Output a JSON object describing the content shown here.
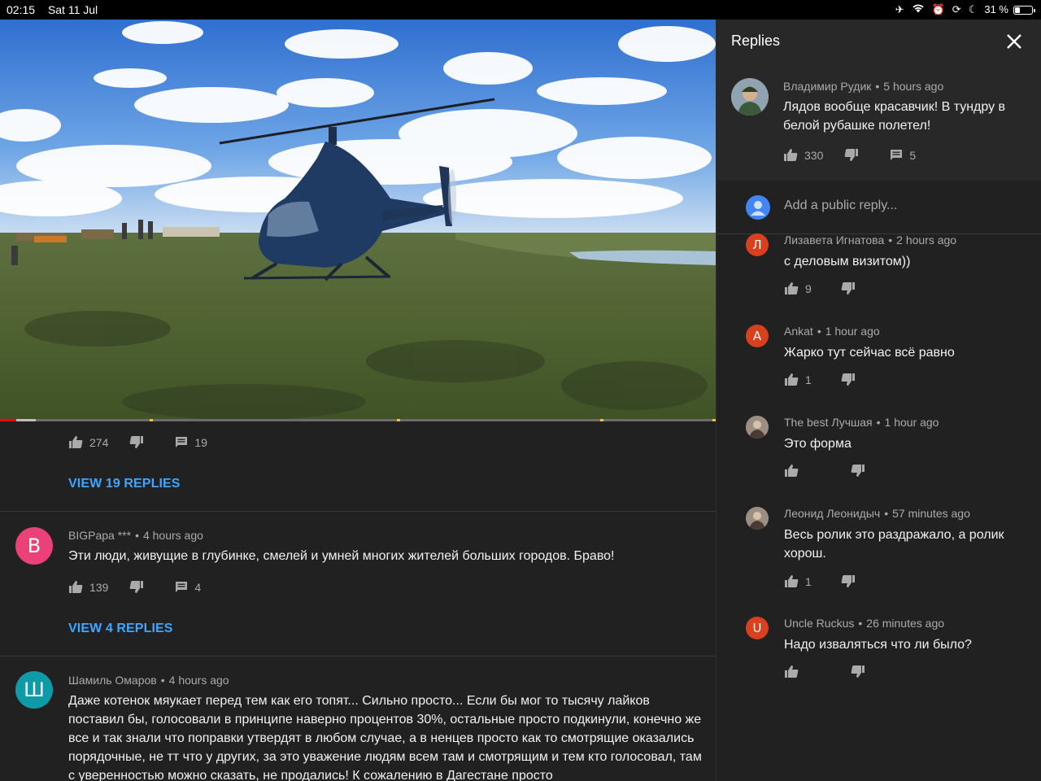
{
  "status_bar": {
    "time": "02:15",
    "date": "Sat 11 Jul",
    "battery_text": "31 %",
    "battery_level": 0.31,
    "icons": [
      "airplane-icon",
      "wifi-icon",
      "alarm-icon",
      "screen-lock-rotation-icon",
      "moon-icon",
      "battery-icon"
    ]
  },
  "video": {
    "progress_played": 0.023,
    "progress_buffered": 0.05
  },
  "main": {
    "top_comment_actions": {
      "likes": "274",
      "replies": "19"
    },
    "top_view_replies": "VIEW 19 REPLIES",
    "comments": [
      {
        "avatar_letter": "B",
        "avatar_color": "#e94178",
        "author": "BIGPapa ***",
        "time": "4 hours ago",
        "text": "Эти люди, живущие в глубинке, смелей и умней многих жителей больших городов. Браво!",
        "likes": "139",
        "replies": "4",
        "view_replies": "VIEW 4 REPLIES"
      },
      {
        "avatar_letter": "Ш",
        "avatar_color": "#0f9aa8",
        "author": "Шамиль Омаров",
        "time": "4 hours ago",
        "text": "Даже котенок мяукает перед тем как его топят... Сильно просто... Если бы мог то тысячу лайков поставил бы, голосовали в принципе наверно процентов 30%, остальные просто подкинули, конечно же все и так знали что поправки утвердят в любом случае, а в ненцев просто как то смотрящие оказались порядочные, не тт что у других, за это уважение людям всем там и смотрящим и тем кто голосовал, там с уверенностью можно сказать, не продались! К сожалению в Дагестане просто"
      }
    ]
  },
  "replies_panel": {
    "title": "Replies",
    "parent": {
      "author": "Владимир Рудик",
      "time": "5 hours ago",
      "text": "Лядов вообще красавчик! В тундру в белой рубашке полетел!",
      "likes": "330",
      "replies": "5"
    },
    "add_reply_placeholder": "Add a public reply...",
    "replies": [
      {
        "avatar_letter": "Л",
        "avatar_color": "#d9411e",
        "author": "Лизавета Игнатова",
        "time": "2 hours ago",
        "text": "с деловым визитом))",
        "likes": "9"
      },
      {
        "avatar_letter": "A",
        "avatar_color": "#d9411e",
        "author": "Ankat",
        "time": "1 hour ago",
        "text": "Жарко тут сейчас всё равно",
        "likes": "1"
      },
      {
        "avatar_letter": "",
        "avatar_color": "#8a6f5a",
        "author": "The best Лучшая",
        "time": "1 hour ago",
        "text": "Это форма",
        "likes": ""
      },
      {
        "avatar_letter": "",
        "avatar_color": "#7a6b5e",
        "author": "Леонид Леонидыч",
        "time": "57 minutes ago",
        "text": "Весь ролик это раздражало, а ролик хорош.",
        "likes": "1"
      },
      {
        "avatar_letter": "U",
        "avatar_color": "#d9411e",
        "author": "Uncle Ruckus",
        "time": "26 minutes ago",
        "text": "Надо изваляться что ли было?",
        "likes": ""
      }
    ]
  }
}
